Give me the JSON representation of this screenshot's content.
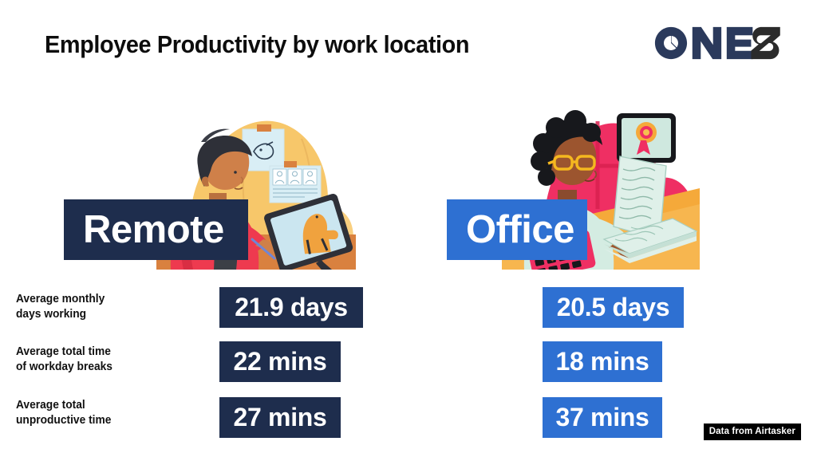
{
  "header": {
    "title": "Employee Productivity by work location",
    "logo": {
      "text_primary": "ONE",
      "text_secondary": "S",
      "color_primary": "#2b3a5c",
      "color_secondary": "#2b2b2b",
      "name": "ones-logo"
    }
  },
  "theme": {
    "background": "#ffffff",
    "remote_color": "#1e2d4d",
    "office_color": "#2e70d2",
    "text_color": "#111111",
    "source_badge_bg": "#000000"
  },
  "columns": [
    {
      "key": "remote",
      "label": "Remote",
      "color": "#1e2d4d",
      "illustration": "remote-worker-drawing-on-tablet-illustration"
    },
    {
      "key": "office",
      "label": "Office",
      "color": "#2e70d2",
      "illustration": "office-worker-with-papers-and-calculator-illustration"
    }
  ],
  "metrics": [
    {
      "label_line1": "Average monthly",
      "label_line2": "days working",
      "remote": "21.9 days",
      "office": "20.5 days"
    },
    {
      "label_line1": "Average total time",
      "label_line2": "of workday breaks",
      "remote": "22 mins",
      "office": "18 mins"
    },
    {
      "label_line1": "Average total",
      "label_line2": "unproductive time",
      "remote": "27 mins",
      "office": "37 mins"
    }
  ],
  "footer": {
    "source": "Data from Airtasker"
  }
}
